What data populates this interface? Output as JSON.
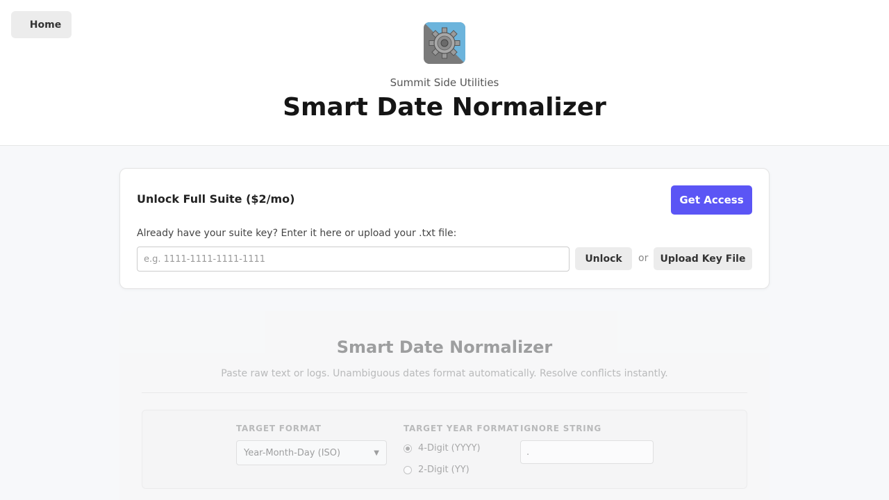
{
  "nav": {
    "home_label": "Home"
  },
  "header": {
    "icon": "gear-icon",
    "company": "Summit Side Utilities",
    "title": "Smart Date Normalizer"
  },
  "unlock": {
    "title": "Unlock Full Suite ($2/mo)",
    "get_access_label": "Get Access",
    "hint": "Already have your suite key? Enter it here or upload your .txt file:",
    "key_placeholder": "e.g. 1111-1111-1111-1111",
    "key_value": "",
    "unlock_label": "Unlock",
    "or_text": "or",
    "upload_label": "Upload Key File"
  },
  "tool": {
    "title": "Smart Date Normalizer",
    "subtitle": "Paste raw text or logs. Unambiguous dates format automatically. Resolve conflicts instantly.",
    "target_format": {
      "label": "TARGET FORMAT",
      "selected": "Year-Month-Day (ISO)"
    },
    "year_format": {
      "label": "TARGET YEAR FORMAT",
      "options": [
        {
          "label": "4-Digit (YYYY)",
          "checked": true
        },
        {
          "label": "2-Digit (YY)",
          "checked": false
        }
      ]
    },
    "ignore": {
      "label": "IGNORE STRING",
      "value": "."
    }
  },
  "colors": {
    "accent": "#5b55f5",
    "background": "#f7f8fa",
    "header_bg": "#ffffff"
  }
}
